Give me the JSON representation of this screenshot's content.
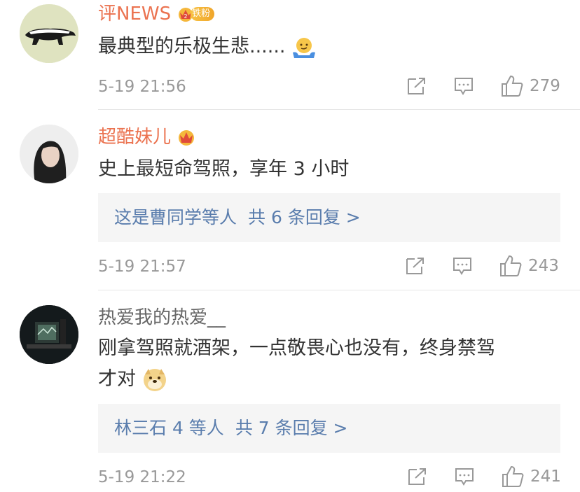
{
  "comments": [
    {
      "username": "评NEWS",
      "fan_badge": "铁粉",
      "text": "最典型的乐极生悲......",
      "emoji": "shrug-emoji",
      "time": "5-19 21:56",
      "likes": "279"
    },
    {
      "username": "超酷妹儿",
      "text": "史上最短命驾照，享年 3 小时",
      "reply_summary": "这是曹同学等人",
      "reply_count": "共 6 条回复 >",
      "time": "5-19 21:57",
      "likes": "243"
    },
    {
      "username": "热爱我的热爱__",
      "text_line1": "刚拿驾照就酒架，一点敬畏心也没有，终身禁驾",
      "text_line2": "才对",
      "emoji": "doge-emoji",
      "reply_summary": "林三石 4 等人",
      "reply_count": "共 7 条回复 >",
      "time": "5-19 21:22",
      "likes": "241"
    }
  ],
  "colors": {
    "vip_name": "#eb7350",
    "normal_name": "#666666",
    "link": "#5a7dad",
    "meta": "#999999",
    "reply_bg": "#f5f5f5"
  }
}
